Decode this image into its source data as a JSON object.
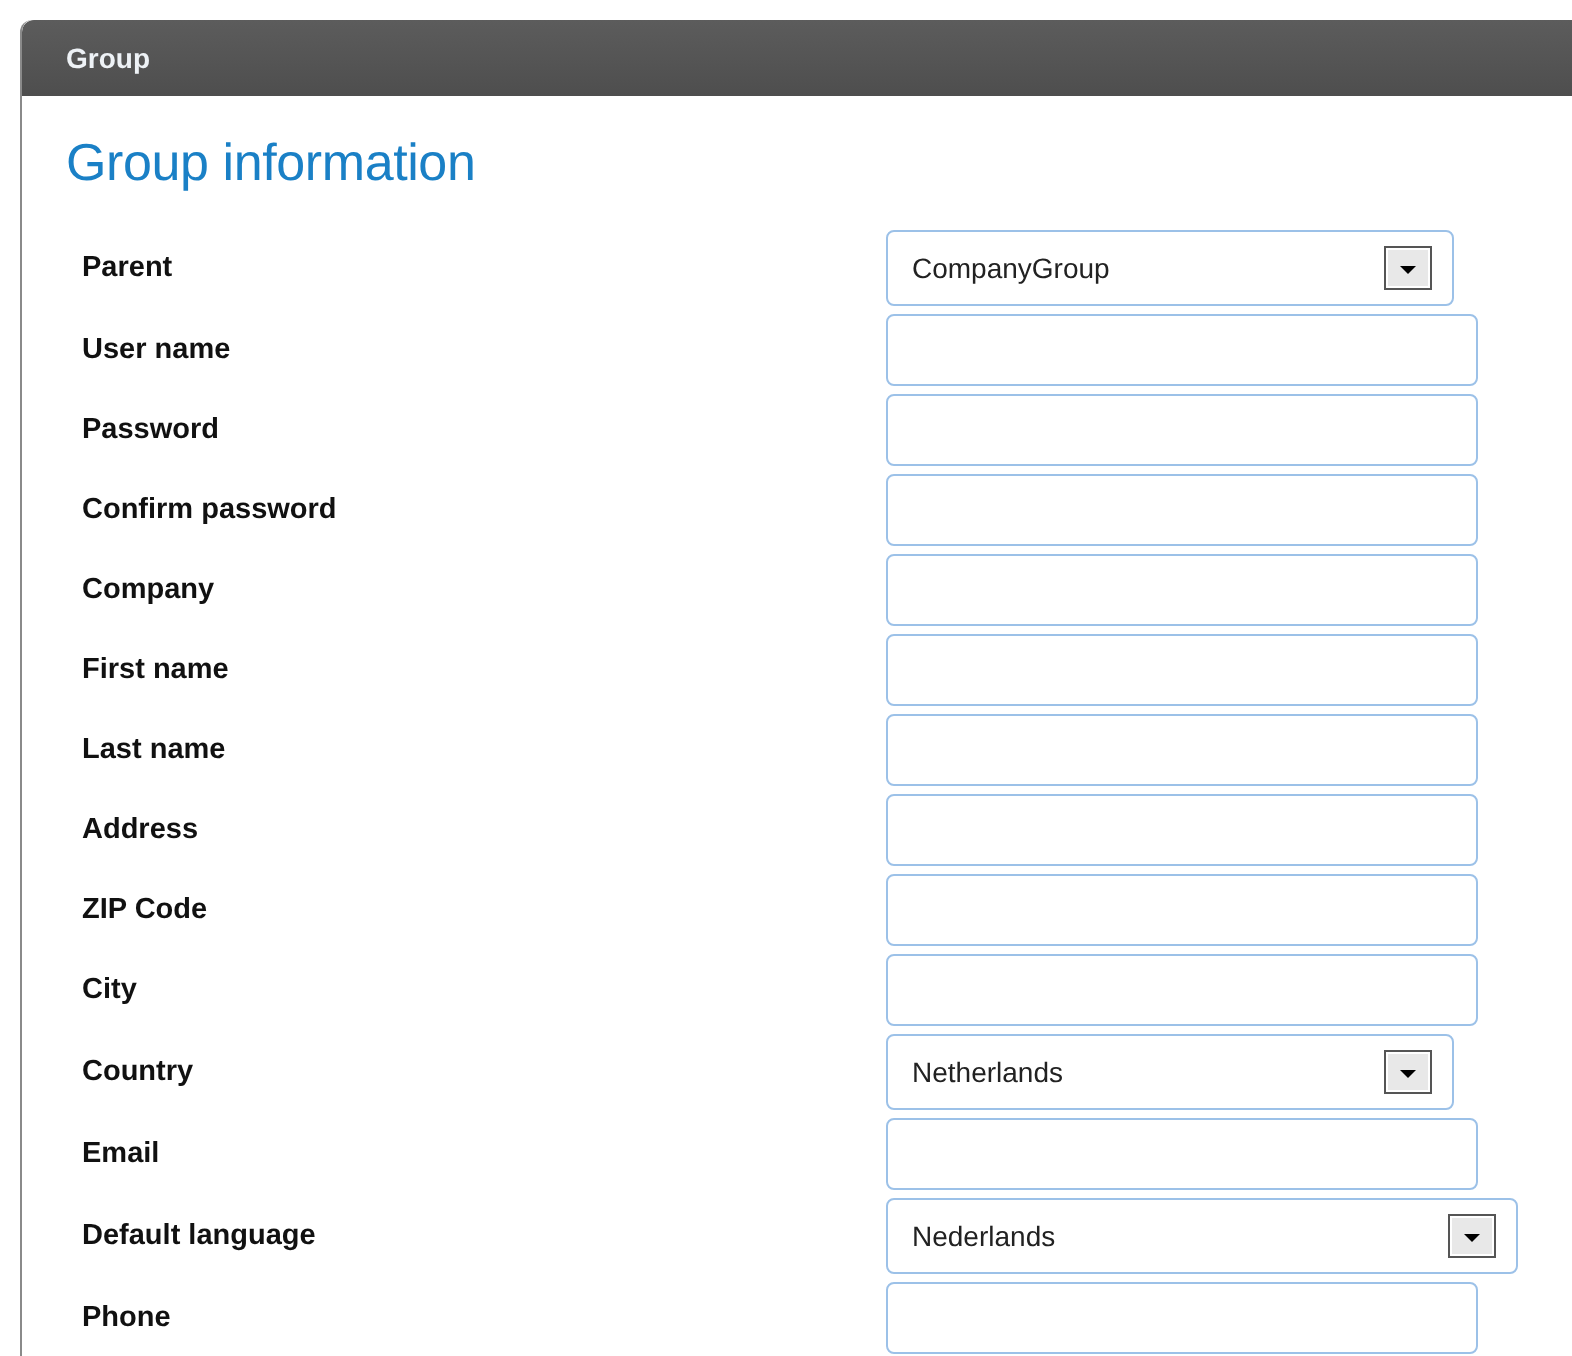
{
  "panel": {
    "title": "Group"
  },
  "heading": "Group information",
  "fields": [
    {
      "label": "Parent",
      "kind": "select",
      "value": "CompanyGroup"
    },
    {
      "label": "User name",
      "kind": "text"
    },
    {
      "label": "Password",
      "kind": "text"
    },
    {
      "label": "Confirm password",
      "kind": "text"
    },
    {
      "label": "Company",
      "kind": "text"
    },
    {
      "label": "First name",
      "kind": "text"
    },
    {
      "label": "Last name",
      "kind": "text"
    },
    {
      "label": "Address",
      "kind": "text"
    },
    {
      "label": "ZIP Code",
      "kind": "text"
    },
    {
      "label": "City",
      "kind": "text"
    },
    {
      "label": "Country",
      "kind": "select",
      "value": "Netherlands"
    },
    {
      "label": "Email",
      "kind": "text"
    },
    {
      "label": "Default language",
      "kind": "select",
      "value": "Nederlands"
    },
    {
      "label": "Phone",
      "kind": "text"
    }
  ]
}
